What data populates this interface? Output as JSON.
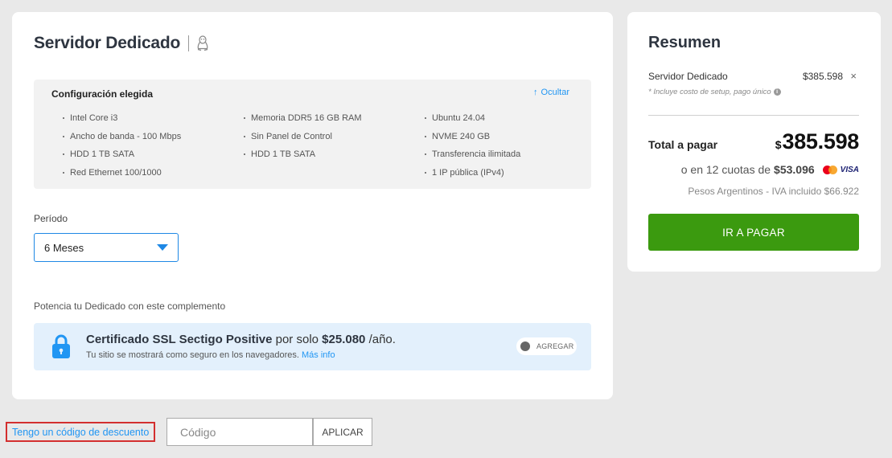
{
  "product": {
    "title": "Servidor Dedicado",
    "os_icon": "linux-penguin-icon"
  },
  "config": {
    "title": "Configuración elegida",
    "hide_label": "Ocultar",
    "columns": [
      [
        "Intel Core i3",
        "Ancho de banda - 100 Mbps",
        "HDD 1 TB SATA",
        "Red Ethernet 100/1000"
      ],
      [
        "Memoria DDR5 16 GB RAM",
        "Sin Panel de Control",
        "HDD 1 TB SATA"
      ],
      [
        "Ubuntu 24.04",
        "NVME 240 GB",
        "Transferencia ilimitada",
        "1 IP pública (IPv4)"
      ]
    ]
  },
  "period": {
    "label": "Período",
    "selected": "6 Meses"
  },
  "addon": {
    "section_label": "Potencia tu Dedicado con este complemento",
    "name": "Certificado SSL Sectigo Positive",
    "price_prefix": "por solo",
    "price": "$25.080",
    "price_suffix": "/año.",
    "description": "Tu sitio se mostrará como seguro en los navegadores.",
    "more_info": "Más info",
    "toggle_label": "AGREGAR",
    "toggle_on": false
  },
  "discount": {
    "link_label": "Tengo un código de descuento",
    "placeholder": "Código",
    "value": "",
    "apply_label": "APLICAR"
  },
  "summary": {
    "title": "Resumen",
    "item_name": "Servidor Dedicado",
    "item_price": "$385.598",
    "remove_icon": "×",
    "setup_note": "* Incluye costo de setup, pago único",
    "total_label": "Total a pagar",
    "total_currency": "$",
    "total_amount": "385.598",
    "installments_text": "o en 12 cuotas de",
    "installments_amount": "$53.096",
    "tax_note": "Pesos Argentinos - IVA incluido $66.922",
    "pay_label": "IR A PAGAR",
    "card_brands": [
      "mastercard",
      "VISA"
    ]
  },
  "colors": {
    "accent_blue": "#2196f3",
    "pay_green": "#3b9a0f",
    "highlight_red": "#d32f2f",
    "addon_bg": "#e3f0fc"
  }
}
